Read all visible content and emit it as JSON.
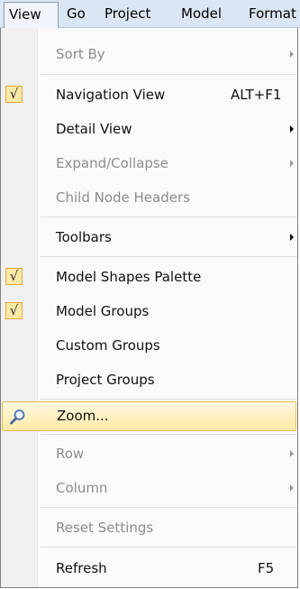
{
  "menubar": {
    "items": [
      "View",
      "Go",
      "Project",
      "Model",
      "Format"
    ]
  },
  "menu": {
    "sort_by": "Sort By",
    "navigation_view": "Navigation View",
    "navigation_view_shortcut": "ALT+F1",
    "detail_view": "Detail View",
    "expand_collapse": "Expand/Collapse",
    "child_node_headers": "Child Node Headers",
    "toolbars": "Toolbars",
    "model_shapes_palette": "Model Shapes Palette",
    "model_groups": "Model Groups",
    "custom_groups": "Custom Groups",
    "project_groups": "Project Groups",
    "zoom": "Zoom...",
    "row": "Row",
    "column": "Column",
    "reset_settings": "Reset Settings",
    "refresh": "Refresh",
    "refresh_shortcut": "F5",
    "check_glyph": "√"
  },
  "colors": {
    "menubar_bg": "#dbe6f4",
    "highlight_border": "#e9bb5e",
    "check_bg": "#fde9a6",
    "disabled_text": "#8d8d8d"
  },
  "icons": {
    "zoom": "magnifier-icon",
    "submenu": "chevron-right-icon",
    "checked": "checkmark-icon"
  }
}
